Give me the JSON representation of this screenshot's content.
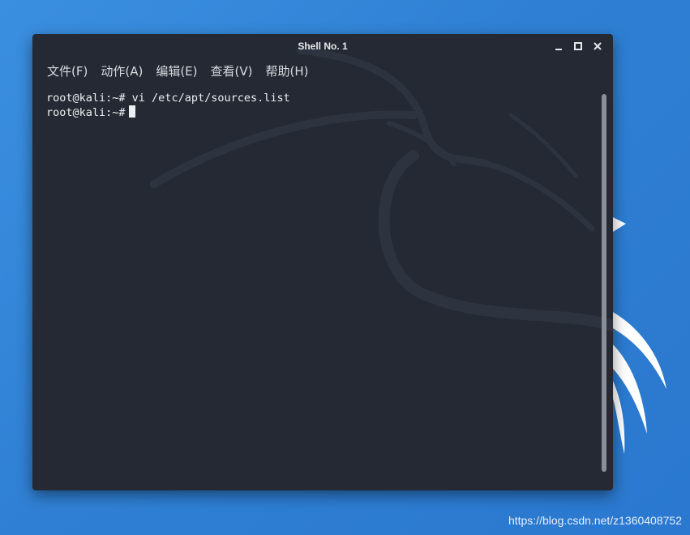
{
  "window": {
    "title": "Shell No. 1"
  },
  "menu": {
    "items": [
      {
        "label": "文件(F)"
      },
      {
        "label": "动作(A)"
      },
      {
        "label": "编辑(E)"
      },
      {
        "label": "查看(V)"
      },
      {
        "label": "帮助(H)"
      }
    ]
  },
  "terminal": {
    "lines": [
      {
        "prompt": "root@kali:~#",
        "command": " vi /etc/apt/sources.list"
      },
      {
        "prompt": "root@kali:~#",
        "command": ""
      }
    ]
  },
  "desktop": {
    "watermark": "https://blog.csdn.net/z1360408752"
  },
  "colors": {
    "desktop_bg": "#2f80d4",
    "terminal_bg": "#242933",
    "text": "#eceff2"
  },
  "icons": {
    "minimize": "minimize-icon",
    "maximize": "maximize-icon",
    "close": "close-icon"
  }
}
